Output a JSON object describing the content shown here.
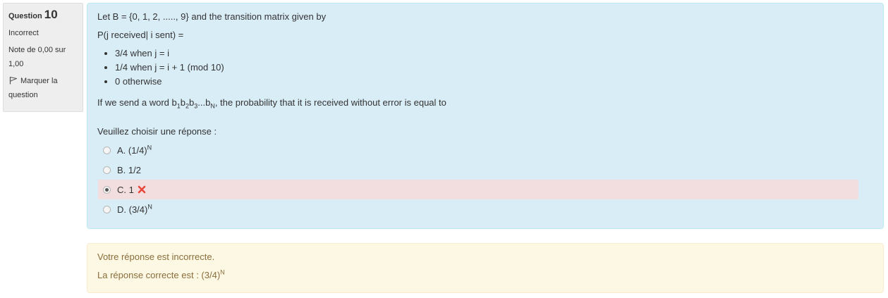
{
  "info": {
    "question_word": "Question",
    "question_number": "10",
    "state": "Incorrect",
    "grade": "Note de 0,00 sur 1,00",
    "flag_label": "Marquer la question",
    "flag_icon": "flag-icon"
  },
  "question": {
    "intro": "Let B = {0, 1, 2, ....., 9} and the transition matrix given by",
    "prob_def": "P(j received| i sent) =",
    "rules": [
      "3/4 when j = i",
      "1/4 when j = i + 1 (mod 10)",
      "0 otherwise"
    ],
    "send_prefix": "If we send a word b",
    "sub_1": "1",
    "b2": "b",
    "sub_2": "2",
    "b3": "b",
    "sub_3": "3",
    "dots": "...b",
    "sub_n": "N",
    "send_suffix": ", the probability that it is received without error is equal to",
    "prompt": "Veuillez choisir une réponse :",
    "answers": [
      {
        "label": "A. (1/4)",
        "sup": "N"
      },
      {
        "label": "B. 1/2",
        "sup": ""
      },
      {
        "label": "C. 1",
        "sup": ""
      },
      {
        "label": "D. (3/4)",
        "sup": "N"
      }
    ],
    "selected_index": 2,
    "incorrect_color": "#f2dede",
    "cross_color": "#e8473e"
  },
  "feedback": {
    "verdict": "Votre réponse est incorrecte.",
    "correct_prefix": "La réponse correcte est : (3/4)",
    "correct_sup": "N"
  }
}
